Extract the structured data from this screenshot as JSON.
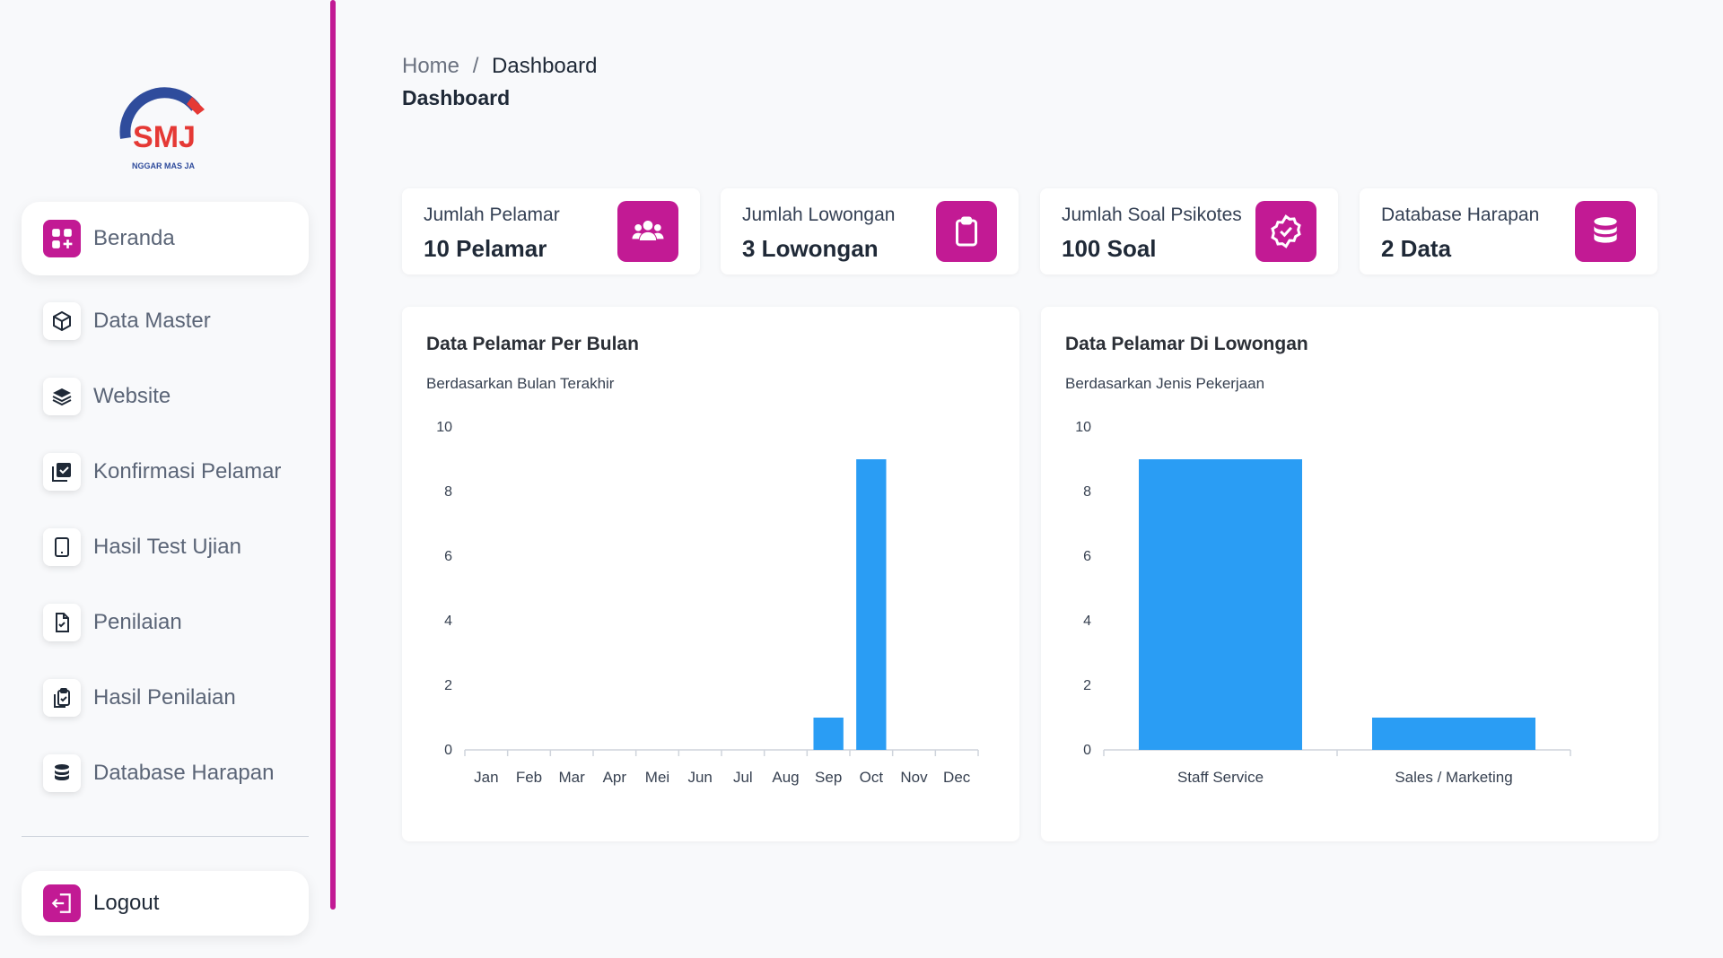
{
  "sidebar": {
    "logo_text": "SMJ",
    "logo_subtext": "NGGAR MAS JA",
    "items": [
      {
        "label": "Beranda",
        "icon": "grid-plus-icon"
      },
      {
        "label": "Data Master",
        "icon": "cube-icon"
      },
      {
        "label": "Website",
        "icon": "layers-icon"
      },
      {
        "label": "Konfirmasi Pelamar",
        "icon": "checklist-icon"
      },
      {
        "label": "Hasil Test Ujian",
        "icon": "tablet-icon"
      },
      {
        "label": "Penilaian",
        "icon": "file-check-icon"
      },
      {
        "label": "Hasil Penilaian",
        "icon": "clipboard-check-icon"
      },
      {
        "label": "Database Harapan",
        "icon": "database-icon"
      }
    ],
    "logout_label": "Logout",
    "accent": "#c21a94"
  },
  "breadcrumb": {
    "home": "Home",
    "separator": "/",
    "current": "Dashboard"
  },
  "page_title": "Dashboard",
  "stats": [
    {
      "label": "Jumlah Pelamar",
      "value": "10 Pelamar",
      "icon": "users-icon"
    },
    {
      "label": "Jumlah Lowongan",
      "value": "3 Lowongan",
      "icon": "clipboard-icon"
    },
    {
      "label": "Jumlah Soal Psikotes",
      "value": "100 Soal",
      "icon": "badge-check-icon"
    },
    {
      "label": "Database Harapan",
      "value": "2 Data",
      "icon": "database-icon"
    }
  ],
  "charts": [
    {
      "title": "Data Pelamar Per Bulan",
      "subtitle": "Berdasarkan Bulan Terakhir"
    },
    {
      "title": "Data Pelamar Di Lowongan",
      "subtitle": "Berdasarkan Jenis Pekerjaan"
    }
  ],
  "chart_data": [
    {
      "type": "bar",
      "title": "Data Pelamar Per Bulan",
      "subtitle": "Berdasarkan Bulan Terakhir",
      "categories": [
        "Jan",
        "Feb",
        "Mar",
        "Apr",
        "Mei",
        "Jun",
        "Jul",
        "Aug",
        "Sep",
        "Oct",
        "Nov",
        "Dec"
      ],
      "values": [
        0,
        0,
        0,
        0,
        0,
        0,
        0,
        0,
        1,
        9,
        0,
        0
      ],
      "ylim": [
        0,
        10
      ],
      "yticks": [
        0,
        2,
        4,
        6,
        8,
        10
      ],
      "color": "#2a9df4",
      "grid": false
    },
    {
      "type": "bar",
      "title": "Data Pelamar Di Lowongan",
      "subtitle": "Berdasarkan Jenis Pekerjaan",
      "categories": [
        "Staff Service",
        "Sales / Marketing"
      ],
      "values": [
        9,
        1
      ],
      "ylim": [
        0,
        10
      ],
      "yticks": [
        0,
        2,
        4,
        6,
        8,
        10
      ],
      "color": "#2a9df4",
      "grid": false
    }
  ]
}
